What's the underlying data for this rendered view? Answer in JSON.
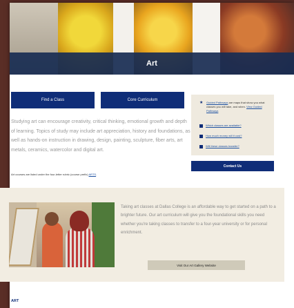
{
  "hero": {
    "title": "Art"
  },
  "buttons": {
    "find_class": "Find a Class",
    "core_curriculum": "Core Curriculum",
    "contact_us": "Contact Us",
    "gallery": "Visit Our Art Gallery Website"
  },
  "intro": {
    "text": "Studying art can encourage creativity, critical thinking, emotional growth and depth of learning. Topics of study may include art appreciation, history and foundations, as well as hands-on instruction in drawing, design, painting, sculpture, fiber arts, art metals, ceramics, watercolor and digital art.",
    "rubric_prefix": "Art courses are listed under the four-letter rubric (course prefix) ",
    "rubric_link": "ARTS",
    "rubric_suffix": "."
  },
  "sidebar": {
    "pathways_link": "Guided Pathways",
    "pathways_text": " are maps that show you what classes you will take, and when. ",
    "pathways_view": "View Guided Pathways",
    "items": [
      {
        "icon": "bookmark-icon",
        "label": "Which classes are available?"
      },
      {
        "icon": "money-icon",
        "label": "How much money will it cost?"
      },
      {
        "icon": "transfer-icon",
        "label": "Will these classes transfer?"
      }
    ]
  },
  "beige": {
    "text": "Taking art classes at Dallas College is an affordable way to get started on a path to a brighter future. Our art curriculum will give you the foundational skills you need whether you're taking classes to transfer to a four-year university or for personal enrichment."
  },
  "footer": {
    "label": "ART"
  },
  "colors": {
    "brand_navy": "#0f2d78",
    "page_bg": "#5a2e26",
    "beige": "#f2ede2"
  }
}
